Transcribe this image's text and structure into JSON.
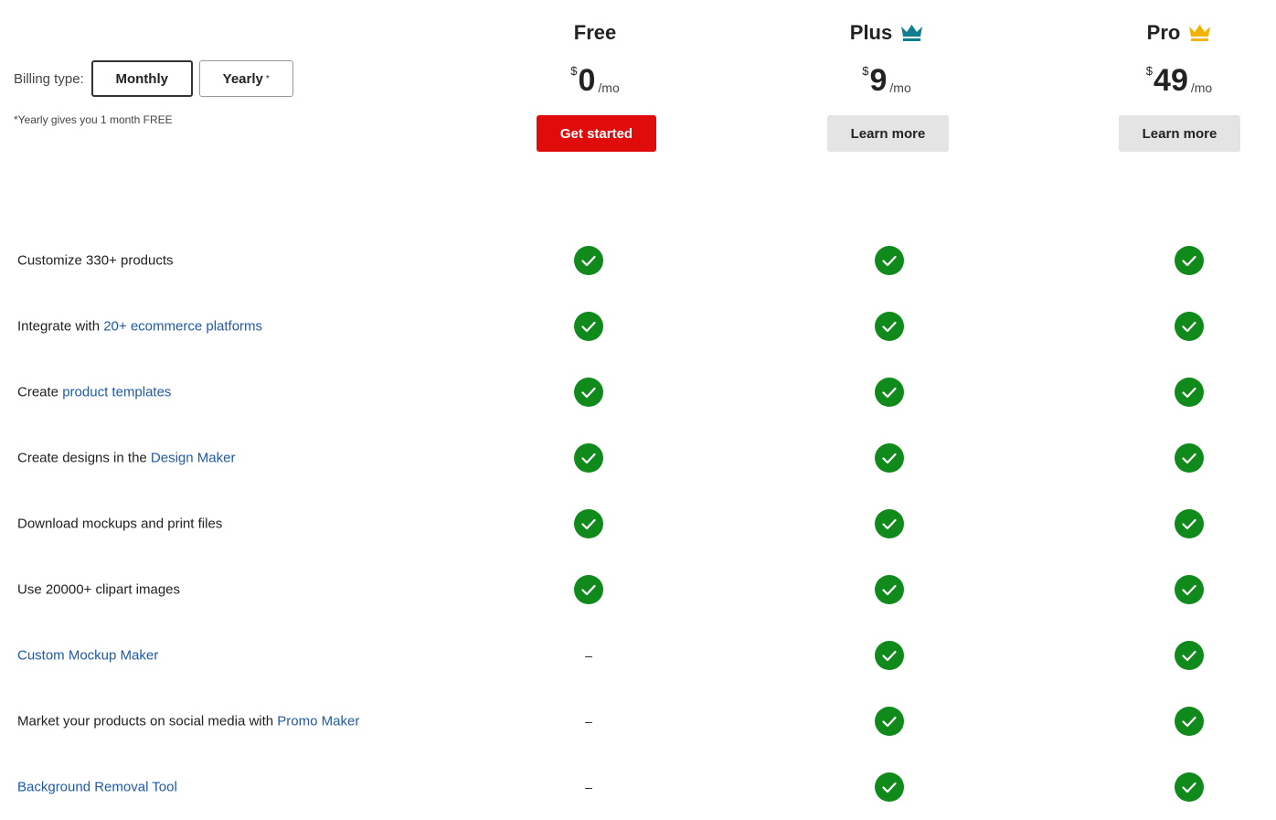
{
  "billing": {
    "label": "Billing type:",
    "monthly_label": "Monthly",
    "yearly_label": "Yearly",
    "yearly_marker": "*",
    "selected": "Monthly",
    "note": "*Yearly gives you 1 month FREE"
  },
  "plans": [
    {
      "name": "Free",
      "currency": "$",
      "amount": "0",
      "per": "/mo",
      "button": "Get started",
      "crown_color": ""
    },
    {
      "name": "Plus",
      "currency": "$",
      "amount": "9",
      "per": "/mo",
      "button": "Learn more",
      "crown_color": "#0f7f8f"
    },
    {
      "name": "Pro",
      "currency": "$",
      "amount": "49",
      "per": "/mo",
      "button": "Learn more",
      "crown_color": "#f5b301"
    }
  ],
  "features": [
    {
      "pre": "Customize 330+ products",
      "link": "",
      "post": "",
      "free": "check",
      "plus": "check",
      "pro": "check"
    },
    {
      "pre": "Integrate with ",
      "link": "20+ ecommerce platforms",
      "post": "",
      "free": "check",
      "plus": "check",
      "pro": "check"
    },
    {
      "pre": "Create ",
      "link": "product templates",
      "post": "",
      "free": "check",
      "plus": "check",
      "pro": "check"
    },
    {
      "pre": "Create designs in the ",
      "link": "Design Maker",
      "post": "",
      "free": "check",
      "plus": "check",
      "pro": "check"
    },
    {
      "pre": "Download mockups and print files",
      "link": "",
      "post": "",
      "free": "check",
      "plus": "check",
      "pro": "check"
    },
    {
      "pre": "Use 20000+ clipart images",
      "link": "",
      "post": "",
      "free": "check",
      "plus": "check",
      "pro": "check"
    },
    {
      "pre": "",
      "link": "Custom Mockup Maker",
      "post": "",
      "free": "–",
      "plus": "check",
      "pro": "check"
    },
    {
      "pre": "Market your products on social media with ",
      "link": "Promo Maker",
      "post": "",
      "free": "–",
      "plus": "check",
      "pro": "check"
    },
    {
      "pre": "",
      "link": "Background Removal Tool",
      "post": "",
      "free": "–",
      "plus": "check",
      "pro": "check"
    }
  ],
  "colors": {
    "check": "#118a1c",
    "link": "#1e5aa8",
    "cta": "#e00b0b"
  },
  "icons": {
    "included": "check-circle-icon",
    "plan_badge": "crown-icon"
  }
}
